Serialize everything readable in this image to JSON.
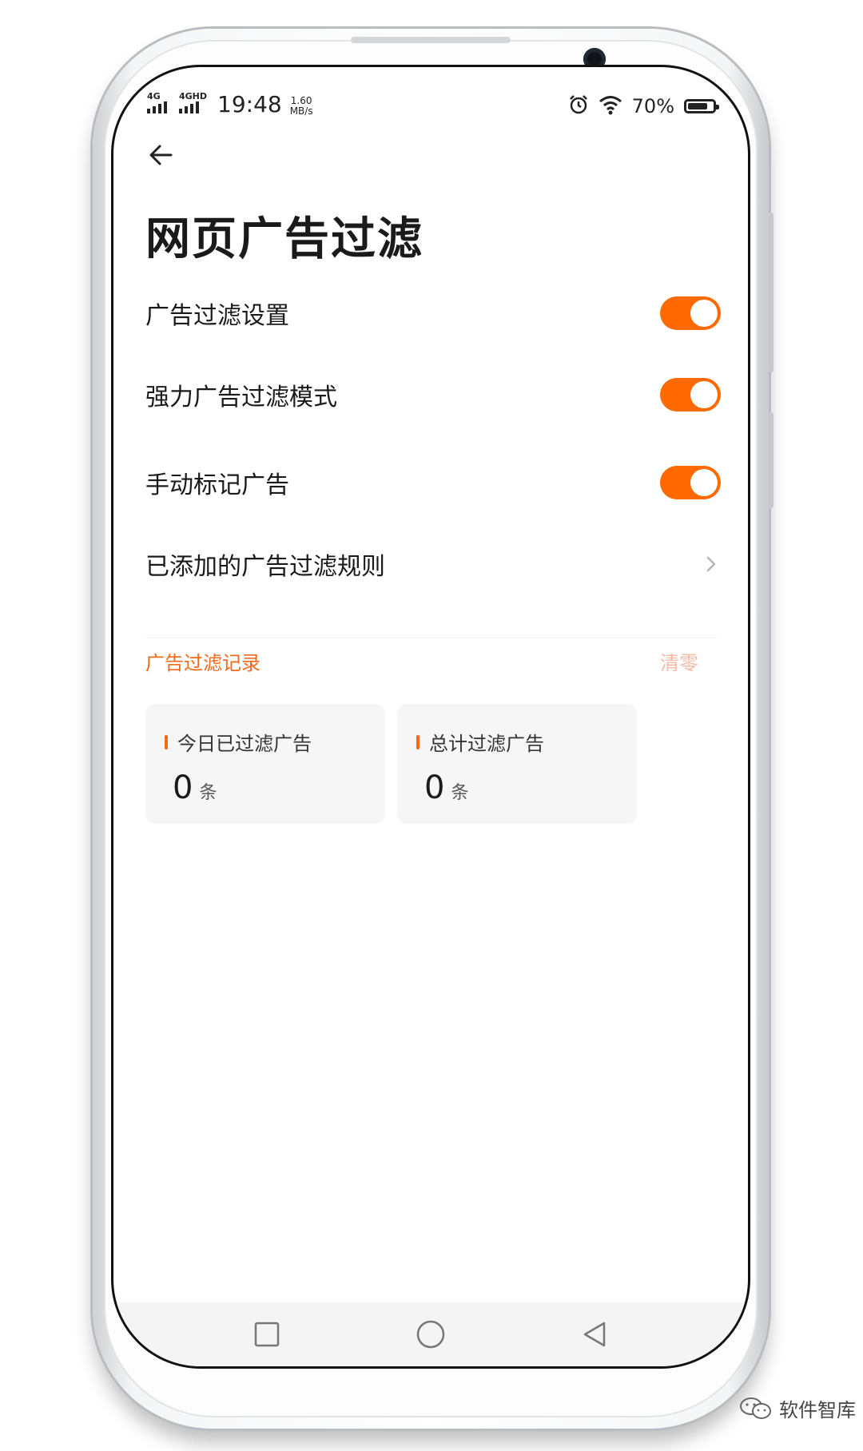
{
  "status_bar": {
    "signal1": "4G",
    "signal2": "4GHD",
    "time": "19:48",
    "speed_value": "1.60",
    "speed_unit": "MB/s",
    "battery": "70%"
  },
  "page": {
    "title": "网页广告过滤"
  },
  "settings": [
    {
      "label": "广告过滤设置",
      "toggle_on": true
    },
    {
      "label": "强力广告过滤模式",
      "toggle_on": true
    },
    {
      "label": "手动标记广告",
      "toggle_on": true
    },
    {
      "label": "已添加的广告过滤规则"
    }
  ],
  "records": {
    "section_title": "广告过滤记录",
    "clear_label": "清零",
    "today": {
      "caption": "今日已过滤广告",
      "value": "0",
      "unit": "条"
    },
    "total": {
      "caption": "总计过滤广告",
      "value": "0",
      "unit": "条"
    }
  },
  "watermark": "软件智库",
  "colors": {
    "accent": "#ff6a00",
    "accent_text": "#f06a1c",
    "clear_text": "#f7b9a6"
  },
  "icons": [
    "back-arrow-icon",
    "chevron-right-icon",
    "alarm-icon",
    "wifi-icon",
    "battery-icon",
    "nav-recents-icon",
    "nav-home-icon",
    "nav-back-icon",
    "wechat-icon"
  ]
}
